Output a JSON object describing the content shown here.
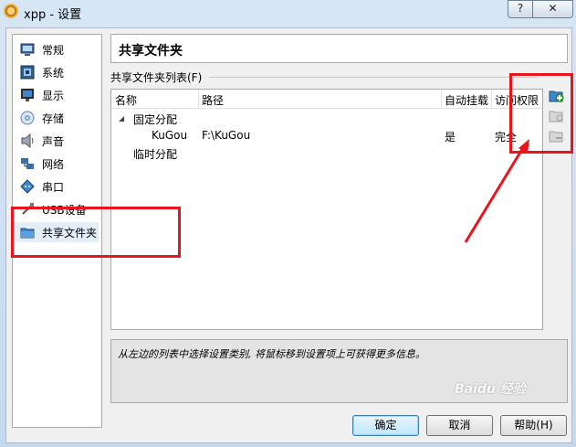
{
  "window": {
    "title": "xpp - 设置",
    "help_label": "?",
    "close_label": "✕"
  },
  "sidebar": {
    "items": [
      {
        "label": "常规",
        "icon": "general-icon"
      },
      {
        "label": "系统",
        "icon": "system-icon"
      },
      {
        "label": "显示",
        "icon": "display-icon"
      },
      {
        "label": "存储",
        "icon": "storage-icon"
      },
      {
        "label": "声音",
        "icon": "audio-icon"
      },
      {
        "label": "网络",
        "icon": "network-icon"
      },
      {
        "label": "串口",
        "icon": "serial-port-icon"
      },
      {
        "label": "USB设备",
        "icon": "usb-icon"
      },
      {
        "label": "共享文件夹",
        "icon": "shared-folder-icon",
        "selected": true
      }
    ]
  },
  "panel": {
    "title": "共享文件夹",
    "group_label": "共享文件夹列表(F)"
  },
  "list": {
    "columns": [
      "名称",
      "路径",
      "自动挂载",
      "访问权限"
    ],
    "groups": [
      {
        "name": "固定分配",
        "toggle": "◢",
        "rows": [
          {
            "name": "KuGou",
            "path": "F:\\KuGou",
            "auto_mount": "是",
            "access": "完全"
          }
        ]
      },
      {
        "name": "临时分配",
        "rows": []
      }
    ]
  },
  "info_text": "从左边的列表中选择设置类别, 将鼠标移到设置项上可获得更多信息。",
  "buttons": {
    "ok": "确定",
    "cancel": "取消",
    "help": "帮助(H)"
  },
  "watermark": "Baidu 经验",
  "colors": {
    "annotation_red": "#e8151c",
    "selection": "#e4eef9"
  }
}
